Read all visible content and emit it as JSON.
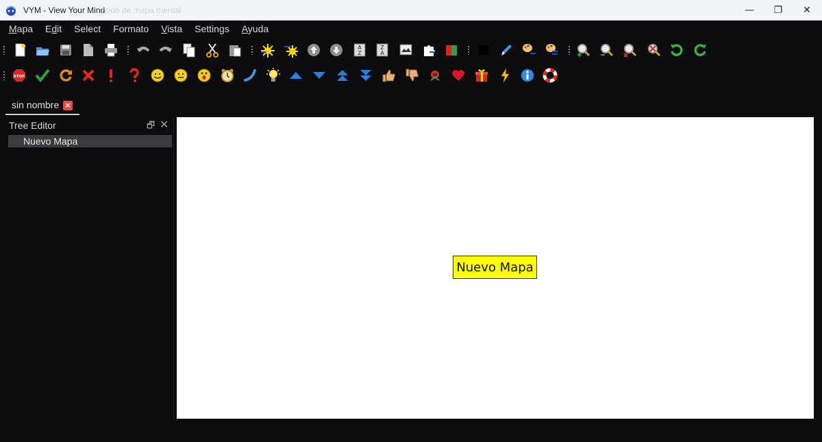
{
  "window": {
    "title": "VYM - View Your Mind",
    "ghost_text": "nodo de mapa mental",
    "min_label": "—",
    "max_label": "❐",
    "close_label": "✕"
  },
  "menu": {
    "items": [
      {
        "label": "Mapa",
        "mnemonic": "M",
        "rest": "apa"
      },
      {
        "label": "Edit",
        "pre": "E",
        "mnemonic": "d",
        "rest": "it"
      },
      {
        "label": "Select"
      },
      {
        "label": "Formato"
      },
      {
        "label": "Vista",
        "mnemonic": "V",
        "rest": "ista"
      },
      {
        "label": "Settings"
      },
      {
        "label": "Ayuda",
        "mnemonic": "A",
        "rest": "yuda"
      }
    ]
  },
  "toolbar1_icons": [
    "new-map-icon",
    "open-icon",
    "save-icon",
    "save-as-icon",
    "print-icon",
    "undo-icon",
    "redo-icon",
    "copy-icon",
    "cut-icon",
    "paste-icon",
    "add-branch-icon",
    "add-branch-above-icon",
    "move-up-icon",
    "move-down-icon",
    "sort-az-icon",
    "sort-za-icon",
    "image-icon",
    "puzzle-icon",
    "color-icon",
    "black-color-icon",
    "pen-icon",
    "format-painter-icon",
    "format-painter-2-icon",
    "zoom-in-icon",
    "zoom-out-icon",
    "zoom-reset-icon",
    "zoom-cancel-icon",
    "rotate-left-icon",
    "rotate-right-icon"
  ],
  "toolbar2_icons": [
    "stop-flag-icon",
    "check-flag-icon",
    "refresh-flag-icon",
    "cross-flag-icon",
    "exclamation-flag-icon",
    "question-flag-icon",
    "smiley-happy-icon",
    "smiley-neutral-icon",
    "smiley-surprised-icon",
    "clock-icon",
    "phone-icon",
    "lamp-icon",
    "arrow-up-icon",
    "arrow-down-icon",
    "double-arrow-up-icon",
    "double-arrow-down-icon",
    "thumb-up-icon",
    "thumb-down-icon",
    "rose-icon",
    "heart-icon",
    "present-icon",
    "flash-icon",
    "info-icon",
    "lifebelt-icon"
  ],
  "tab": {
    "label": "sin nombre",
    "close_label": "×"
  },
  "tree_editor": {
    "title": "Tree Editor",
    "float_label": "🗗",
    "close_label": "✕",
    "rows": [
      {
        "label": "Nuevo Mapa"
      }
    ]
  },
  "canvas": {
    "root_node": "Nuevo Mapa",
    "node_color": "#ffff00"
  }
}
